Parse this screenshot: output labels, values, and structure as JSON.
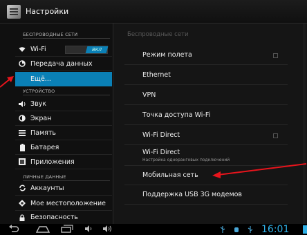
{
  "window": {
    "title": "Настройки"
  },
  "left_panel": {
    "headers": [
      "БЕСПРОВОДНЫЕ СЕТИ",
      "УСТРОЙСТВО",
      "ЛИЧНЫЕ ДАННЫЕ"
    ],
    "items": [
      {
        "label": "Wi-Fi",
        "icon": "wifi-icon"
      },
      {
        "label": "Передача данных",
        "icon": "data-usage-icon"
      },
      {
        "label": "Ещё...",
        "icon": "",
        "selected": true
      },
      {
        "label": "Звук",
        "icon": "speaker-icon"
      },
      {
        "label": "Экран",
        "icon": "brightness-icon"
      },
      {
        "label": "Память",
        "icon": "storage-icon"
      },
      {
        "label": "Батарея",
        "icon": "battery-icon"
      },
      {
        "label": "Приложения",
        "icon": "apps-icon"
      },
      {
        "label": "Аккаунты",
        "icon": "sync-icon"
      },
      {
        "label": "Мое местоположение",
        "icon": "location-icon"
      },
      {
        "label": "Безопасность",
        "icon": "lock-icon"
      }
    ],
    "wifi_toggle": "ВКЛ"
  },
  "right_panel": {
    "header": "Беспроводные сети",
    "items": [
      {
        "title": "Режим полета",
        "checkbox": true
      },
      {
        "title": "Ethernet"
      },
      {
        "title": "VPN"
      },
      {
        "title": "Точка доступа Wi-Fi"
      },
      {
        "title": "Wi-Fi Direct",
        "checkbox": true
      },
      {
        "title": "Wi-Fi Direct",
        "subtitle": "Настройка одноранговых подключений"
      },
      {
        "title": "Мобильная сеть"
      },
      {
        "title": "Поддержка USB 3G модемов"
      }
    ]
  },
  "navbar": {
    "clock": "16:01",
    "buttons": [
      "back-icon",
      "home-icon",
      "recent-apps-icon",
      "volume-down-icon",
      "volume-up-icon"
    ]
  },
  "colors": {
    "accent": "#0a80b6",
    "clock": "#2fb1e8",
    "annotation": "#e8141c"
  }
}
